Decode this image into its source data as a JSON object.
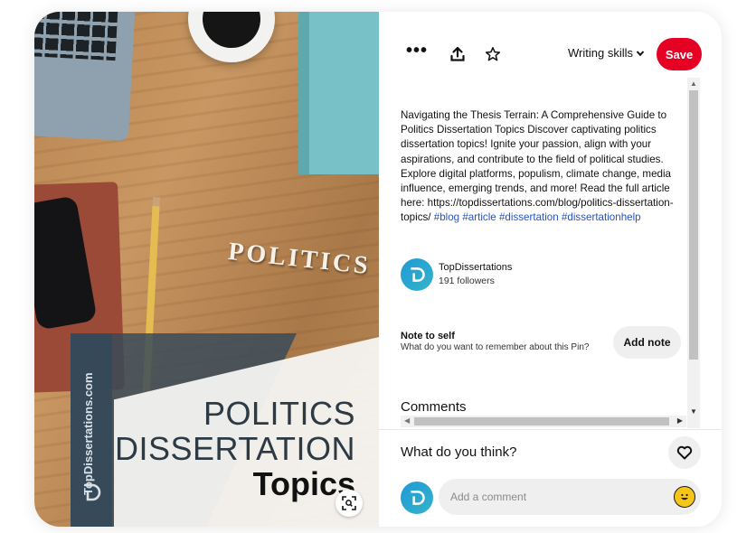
{
  "image": {
    "letters": "POLITICS",
    "brand_vertical": "TopDissertations.com",
    "title_line1": "POLITICS",
    "title_line2": "DISSERTATION",
    "title_line3": "Topics",
    "lens_icon": "visual-search-icon"
  },
  "toolbar": {
    "more_label": "•••",
    "share_icon": "share-upload-icon",
    "star_icon": "star-icon",
    "board_name": "Writing skills",
    "save_label": "Save"
  },
  "description": {
    "text": "Navigating the Thesis Terrain: A Comprehensive Guide to Politics Dissertation Topics Discover captivating politics dissertation topics! Ignite your passion, align with your aspirations, and contribute to the field of political studies. Explore digital platforms, populism, climate change, media influence, emerging trends, and more! Read the full article here: https://topdissertations.com/blog/politics-dissertation-topics/",
    "tags": [
      "#blog",
      "#article",
      "#dissertation",
      "#dissertationhelp"
    ]
  },
  "creator": {
    "name": "TopDissertations",
    "followers": "191 followers"
  },
  "note": {
    "title": "Note to self",
    "subtitle": "What do you want to remember about this Pin?",
    "button_label": "Add note"
  },
  "comments": {
    "heading": "Comments",
    "question": "What do you think?",
    "input_placeholder": "Add a comment",
    "heart_icon": "heart-icon",
    "emoji_icon": "emoji-icon"
  },
  "colors": {
    "save_red": "#e60023",
    "hashtag_blue": "#2a52be",
    "avatar_teal": "#1e9ad6"
  }
}
